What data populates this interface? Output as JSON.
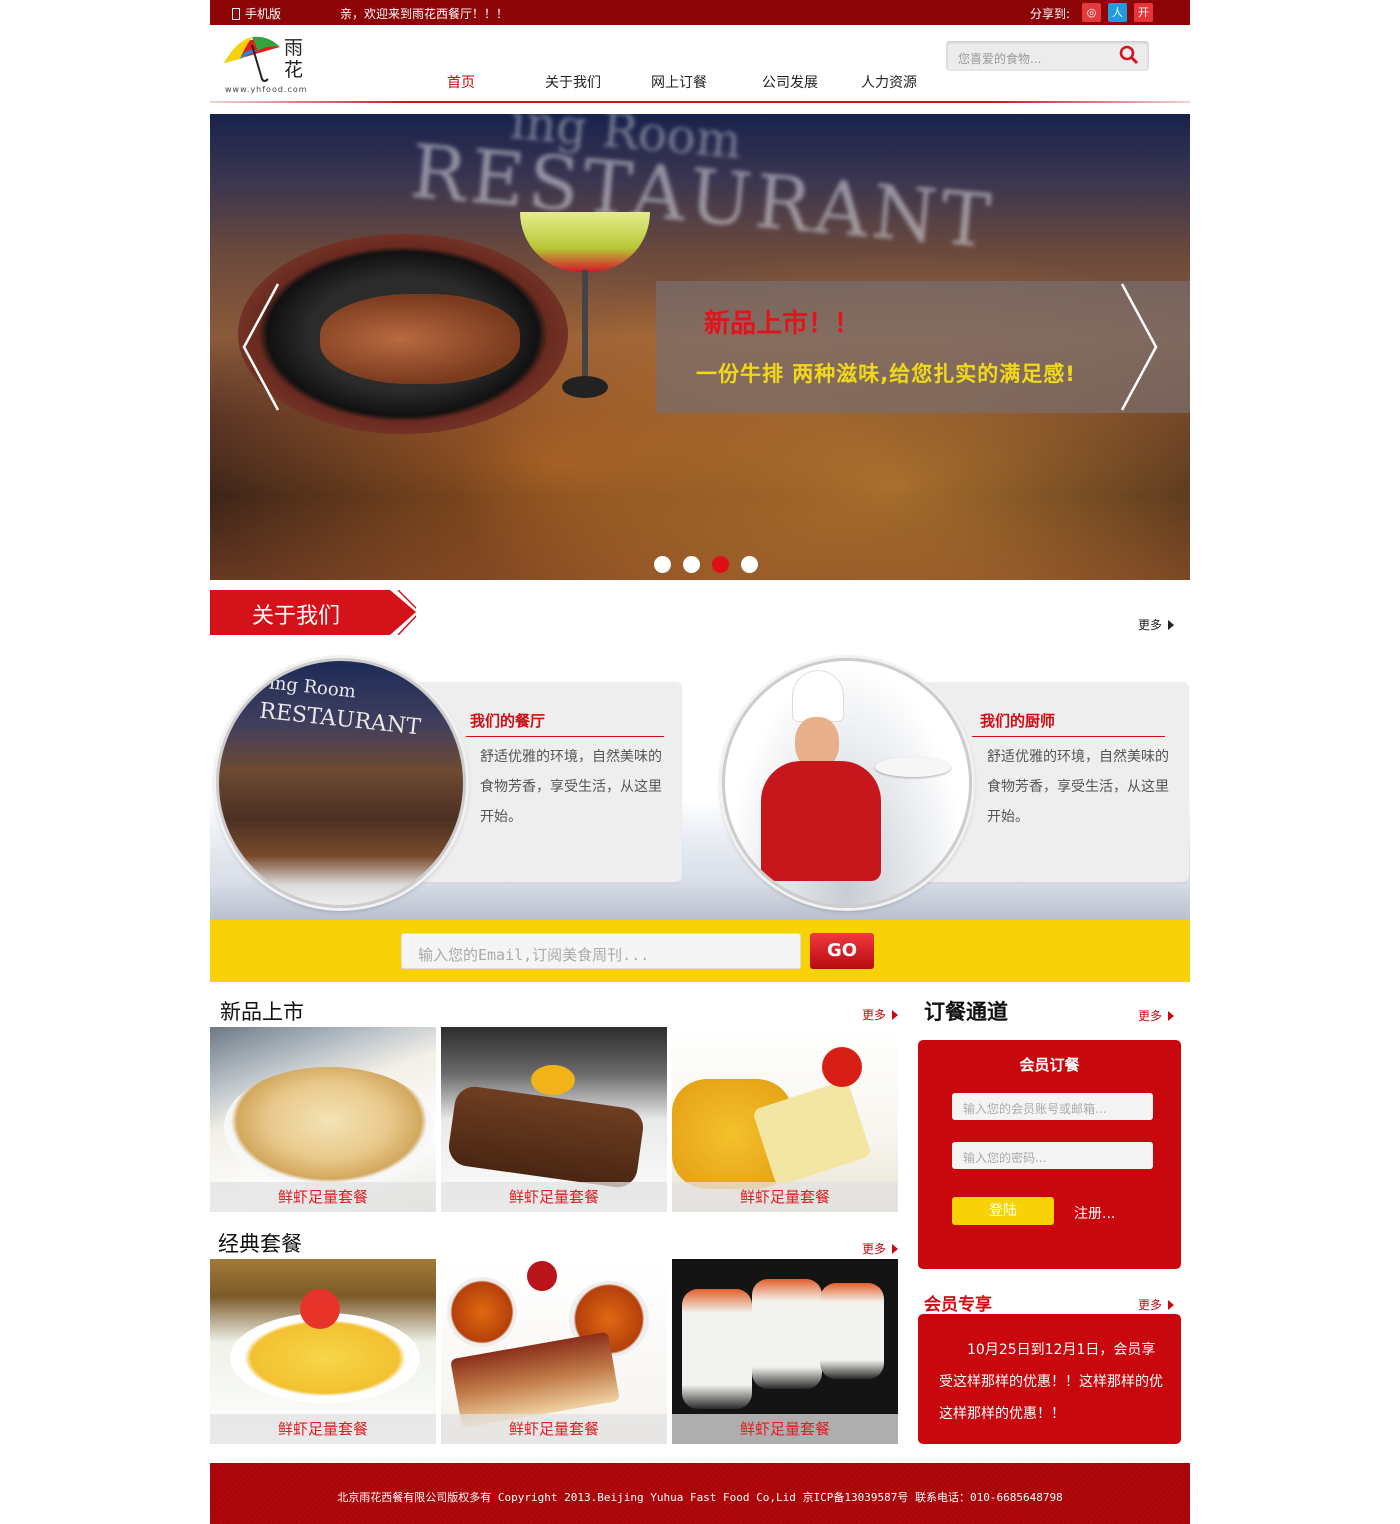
{
  "topbar": {
    "mobile": "手机版",
    "welcome": "亲，欢迎来到雨花西餐厅！！！",
    "share_label": "分享到:",
    "share_icons": [
      {
        "name": "weibo-icon",
        "glyph": "◎",
        "color": "#e43a3d"
      },
      {
        "name": "renren-icon",
        "glyph": "人",
        "color": "#1d9de0"
      },
      {
        "name": "kaixin-icon",
        "glyph": "开",
        "color": "#e8353a"
      }
    ]
  },
  "header": {
    "logo_line1": "雨",
    "logo_line2": "花",
    "logo_url": "www.yhfood.com",
    "nav": [
      "首页",
      "关于我们",
      "网上订餐",
      "公司发展",
      "人力资源"
    ],
    "search_placeholder": "您喜爱的食物..."
  },
  "banner": {
    "sign_text": "RESTAURANT",
    "sign_text2": "ing Room",
    "headline": "新品上市！！",
    "subline": "一份牛排 两种滋味,给您扎实的满足感!",
    "slides": 4,
    "active_slide": 3
  },
  "about": {
    "title": "关于我们",
    "more": "更多",
    "cards": [
      {
        "title": "我们的餐厅",
        "text": "舒适优雅的环境，自然美味的食物芳香，享受生活，从这里开始。",
        "img_sign": "RESTAURANT",
        "img_sign2": "ing Room"
      },
      {
        "title": "我们的厨师",
        "text": "舒适优雅的环境，自然美味的食物芳香，享受生活，从这里开始。"
      }
    ]
  },
  "subscribe": {
    "placeholder": "输入您的Email,订阅美食周刊...",
    "button": "GO"
  },
  "new_products": {
    "title": "新品上市",
    "more": "更多",
    "items": [
      "鲜虾足量套餐",
      "鲜虾足量套餐",
      "鲜虾足量套餐"
    ]
  },
  "classic": {
    "title": "经典套餐",
    "more": "更多",
    "items": [
      "鲜虾足量套餐",
      "鲜虾足量套餐",
      "鲜虾足量套餐"
    ]
  },
  "order": {
    "title": "订餐通道",
    "more": "更多",
    "panel_title": "会员订餐",
    "account_placeholder": "输入您的会员账号或邮箱...",
    "password_placeholder": "输入您的密码...",
    "login": "登陆",
    "register": "注册..."
  },
  "member": {
    "title": "会员专享",
    "more": "更多",
    "text": "10月25日到12月1日，会员享受这样那样的优惠！！这样那样的优这样那样的优惠！！"
  },
  "footer": {
    "text": "北京雨花西餐有限公司版权多有 Copyright 2013.Beijing Yuhua Fast Food Co,Lid 京ICP备13039587号   联系电话：010-6685648798"
  },
  "colors": {
    "brand_red": "#c9080e",
    "dark_red": "#8e0508",
    "yellow": "#f9d107"
  }
}
